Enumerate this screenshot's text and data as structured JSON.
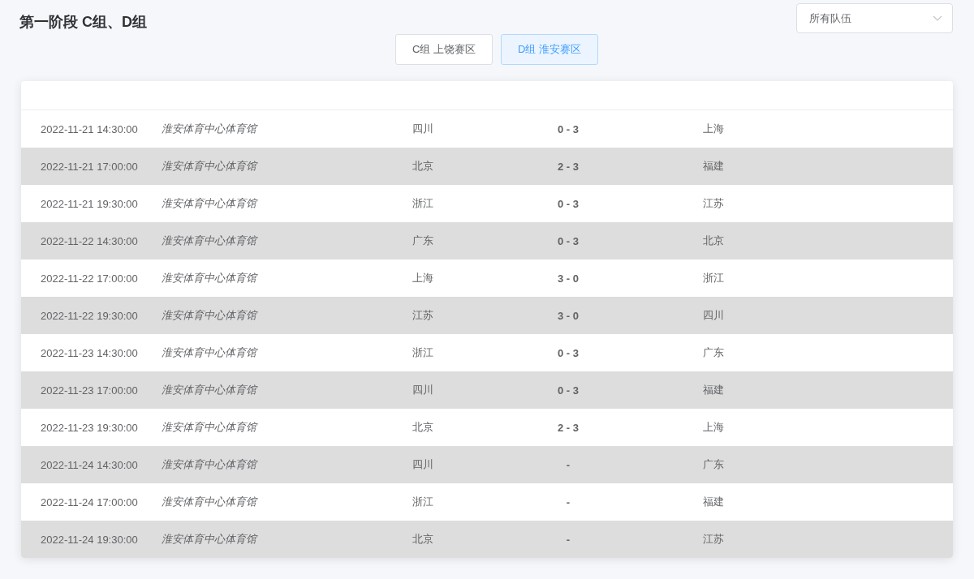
{
  "title": "第一阶段 C组、D组",
  "team_filter": {
    "value": "所有队伍"
  },
  "tabs": [
    {
      "label": "C组 上饶赛区",
      "selected": false
    },
    {
      "label": "D组 淮安赛区",
      "selected": true
    }
  ],
  "matches": [
    {
      "time": "2022-11-21 14:30:00",
      "venue": "淮安体育中心体育馆",
      "home": "四川",
      "score": "0 - 3",
      "away": "上海"
    },
    {
      "time": "2022-11-21 17:00:00",
      "venue": "淮安体育中心体育馆",
      "home": "北京",
      "score": "2 - 3",
      "away": "福建"
    },
    {
      "time": "2022-11-21 19:30:00",
      "venue": "淮安体育中心体育馆",
      "home": "浙江",
      "score": "0 - 3",
      "away": "江苏"
    },
    {
      "time": "2022-11-22 14:30:00",
      "venue": "淮安体育中心体育馆",
      "home": "广东",
      "score": "0 - 3",
      "away": "北京"
    },
    {
      "time": "2022-11-22 17:00:00",
      "venue": "淮安体育中心体育馆",
      "home": "上海",
      "score": "3 - 0",
      "away": "浙江"
    },
    {
      "time": "2022-11-22 19:30:00",
      "venue": "淮安体育中心体育馆",
      "home": "江苏",
      "score": "3 - 0",
      "away": "四川"
    },
    {
      "time": "2022-11-23 14:30:00",
      "venue": "淮安体育中心体育馆",
      "home": "浙江",
      "score": "0 - 3",
      "away": "广东"
    },
    {
      "time": "2022-11-23 17:00:00",
      "venue": "淮安体育中心体育馆",
      "home": "四川",
      "score": "0 - 3",
      "away": "福建"
    },
    {
      "time": "2022-11-23 19:30:00",
      "venue": "淮安体育中心体育馆",
      "home": "北京",
      "score": "2 - 3",
      "away": "上海"
    },
    {
      "time": "2022-11-24 14:30:00",
      "venue": "淮安体育中心体育馆",
      "home": "四川",
      "score": "-",
      "away": "广东"
    },
    {
      "time": "2022-11-24 17:00:00",
      "venue": "淮安体育中心体育馆",
      "home": "浙江",
      "score": "-",
      "away": "福建"
    },
    {
      "time": "2022-11-24 19:30:00",
      "venue": "淮安体育中心体育馆",
      "home": "北京",
      "score": "-",
      "away": "江苏"
    }
  ]
}
